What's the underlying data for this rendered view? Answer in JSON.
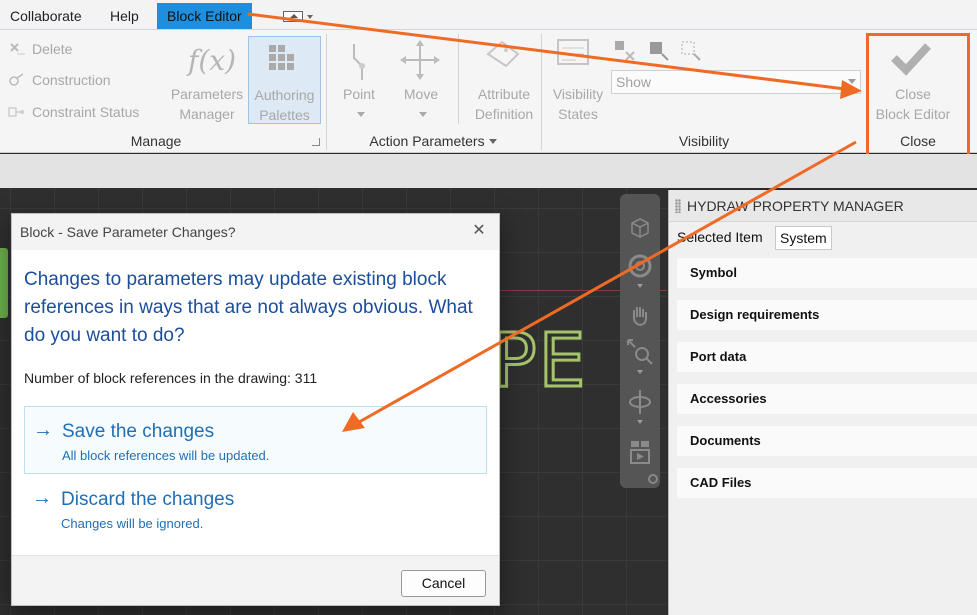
{
  "menu": {
    "tabs": [
      "Collaborate",
      "Help",
      "Block Editor"
    ]
  },
  "ribbon": {
    "manage": {
      "title": "Manage",
      "delete": "Delete",
      "construction": "Construction",
      "constraint_status": "Constraint Status",
      "parameters_manager_1": "Parameters",
      "parameters_manager_2": "Manager",
      "authoring_palettes_1": "Authoring",
      "authoring_palettes_2": "Palettes"
    },
    "action_parameters": {
      "title": "Action Parameters",
      "point": "Point",
      "move": "Move",
      "attribute_definition_1": "Attribute",
      "attribute_definition_2": "Definition"
    },
    "visibility": {
      "title": "Visibility",
      "visibility_states_1": "Visibility",
      "visibility_states_2": "States",
      "show_value": "Show"
    },
    "close": {
      "title": "Close",
      "close_block_editor_1": "Close",
      "close_block_editor_2": "Block Editor"
    }
  },
  "canvas": {
    "text_fragment": "PE"
  },
  "property_manager": {
    "title": "HYDRAW PROPERTY MANAGER",
    "tabs": [
      "Selected Item",
      "System"
    ],
    "sections": [
      "Symbol",
      "Design requirements",
      "Port data",
      "Accessories",
      "Documents",
      "CAD Files"
    ]
  },
  "dialog": {
    "title": "Block - Save Parameter Changes?",
    "heading": "Changes to parameters may update existing block references in ways that are not always obvious. What do you want to do?",
    "count_text": "Number of block references in the drawing: 311",
    "options": [
      {
        "title": "Save the changes",
        "subtitle": "All block references will be updated."
      },
      {
        "title": "Discard the changes",
        "subtitle": "Changes will be ignored."
      }
    ],
    "cancel_label": "Cancel"
  },
  "colors": {
    "accent": "#1d8fde",
    "annotation": "#ef6a24",
    "link": "#1f6fb8",
    "heading": "#1b4e9b"
  }
}
